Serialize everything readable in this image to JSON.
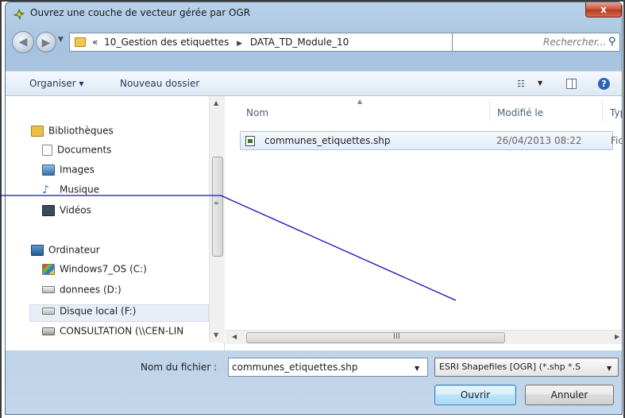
{
  "window": {
    "title": "Ouvrez une couche de vecteur gérée par OGR",
    "close_label": "x"
  },
  "address": {
    "prefix": "«",
    "crumbs": [
      "10_Gestion des etiquettes",
      "DATA_TD_Module_10"
    ]
  },
  "search": {
    "placeholder": "Rechercher..."
  },
  "toolbar": {
    "organize_label": "Organiser ▾",
    "newfolder_label": "Nouveau dossier",
    "help_label": "?"
  },
  "nav": {
    "libraries": "Bibliothèques",
    "documents": "Documents",
    "images": "Images",
    "music": "Musique",
    "videos": "Vidéos",
    "computer": "Ordinateur",
    "drive_c": "Windows7_OS (C:)",
    "drive_d": "donnees (D:)",
    "drive_f": "Disque local (F:)",
    "network": "CONSULTATION (\\\\CEN-LIN"
  },
  "columns": {
    "name": "Nom",
    "modified": "Modifié le",
    "type": "Typ"
  },
  "files": [
    {
      "name": "communes_etiquettes.shp",
      "modified": "26/04/2013 08:22",
      "type": "Fich"
    }
  ],
  "scroll": {
    "grip_h": "III",
    "grip_v": "≡"
  },
  "filename": {
    "label": "Nom du fichier :",
    "value": "communes_etiquettes.shp"
  },
  "filter": {
    "value": "ESRI Shapefiles [OGR] (*.shp *.S"
  },
  "buttons": {
    "open": "Ouvrir",
    "cancel": "Annuler"
  },
  "colors": {
    "annotation_line": "#1010c8",
    "selection": "#cde4fb",
    "title_gradient": "#b9d1ea"
  }
}
